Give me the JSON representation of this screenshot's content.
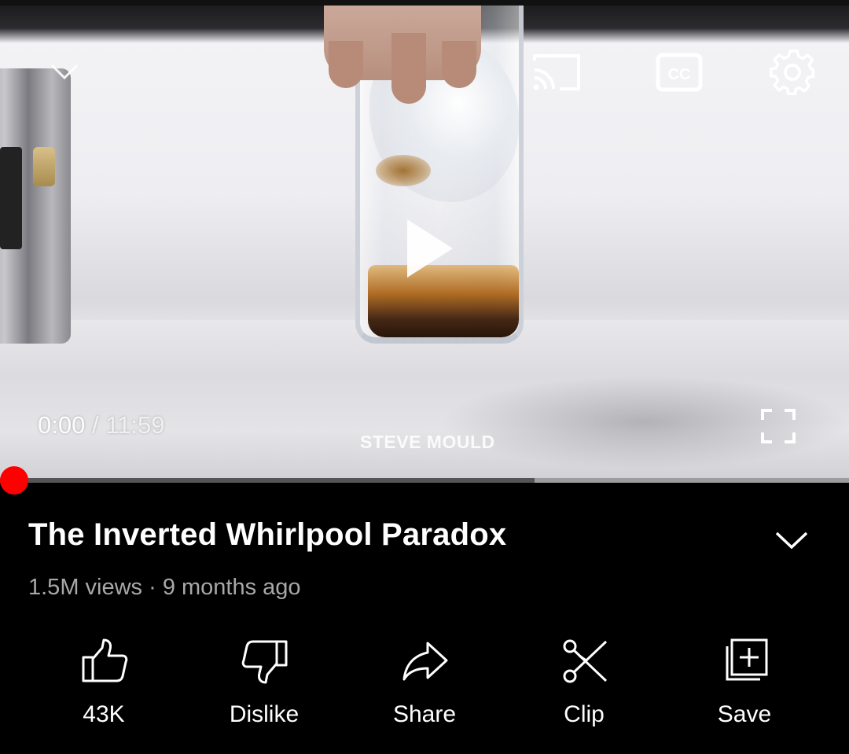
{
  "player": {
    "current_time": "0:00",
    "separator": "/",
    "duration": "11:59",
    "watermark": "STEVE MOULD",
    "progress_fraction": 0.0,
    "buffered_fraction": 0.37,
    "scrubber_color": "#ff0000",
    "icons": {
      "minimize": "chevron-down-icon",
      "cast": "cast-icon",
      "captions": "closed-captions-icon",
      "settings": "gear-icon",
      "play": "play-icon",
      "fullscreen": "fullscreen-icon"
    },
    "captions_label": "CC"
  },
  "video": {
    "title": "The Inverted Whirlpool Paradox",
    "meta": "1.5M views · 9 months ago"
  },
  "actions": [
    {
      "label": "43K",
      "icon": "thumbs-up-icon"
    },
    {
      "label": "Dislike",
      "icon": "thumbs-down-icon"
    },
    {
      "label": "Share",
      "icon": "share-icon"
    },
    {
      "label": "Clip",
      "icon": "scissors-icon"
    },
    {
      "label": "Save",
      "icon": "save-playlist-icon"
    }
  ],
  "colors": {
    "background": "#000000",
    "text_primary": "#ffffff",
    "text_secondary": "#a8a8a8",
    "accent": "#ff0000"
  }
}
